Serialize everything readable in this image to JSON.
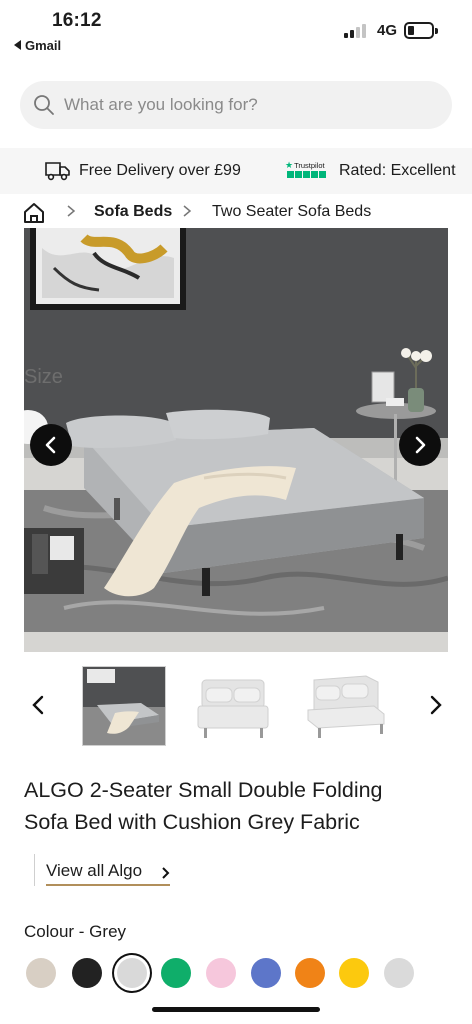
{
  "status_bar": {
    "time": "16:12",
    "back_app": "Gmail",
    "network": "4G"
  },
  "search": {
    "placeholder": "What are you looking for?",
    "icon": "search-icon"
  },
  "promo_strip": {
    "delivery_text": "Free Delivery over £99",
    "trustpilot_name": "Trustpilot",
    "rating_text": "Rated: Excellent",
    "trustpilot_color": "#00b67a"
  },
  "breadcrumb": {
    "home_icon": "home-icon",
    "items": [
      "Sofa Beds",
      "Two Seater Sofa Beds"
    ]
  },
  "gallery": {
    "overlay_text": "Size",
    "thumbnails": [
      "Lifestyle photo",
      "Sofa bed upright",
      "Sofa bed angled"
    ],
    "active_index": 0
  },
  "product": {
    "title_line1": "ALGO 2-Seater Small Double Folding",
    "title_line2": "Sofa Bed with Cushion Grey Fabric",
    "view_all_label": "View all Algo",
    "accent_color": "#b18f5b"
  },
  "colour": {
    "label": "Colour - Grey",
    "selected_index": 2,
    "swatches": [
      "#d8cfc4",
      "#222222",
      "#d9d9d9",
      "#0fae6a",
      "#f6c7dc",
      "#5d76c9",
      "#f08317",
      "#fcc90e",
      "#dadada"
    ]
  }
}
